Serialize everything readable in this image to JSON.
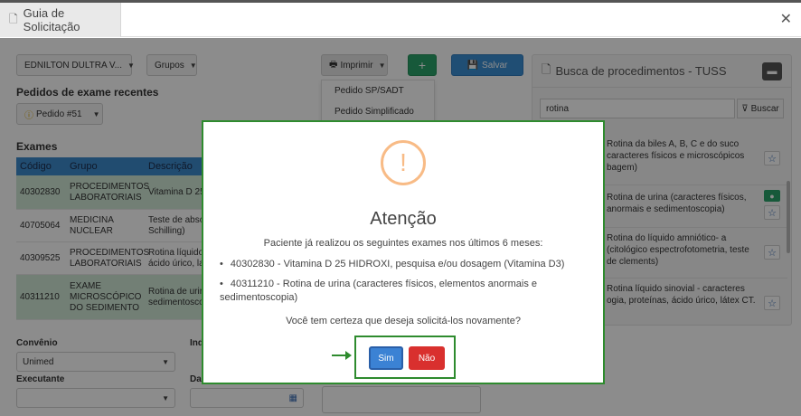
{
  "window": {
    "title": "Guia de Solicitação"
  },
  "toolbar": {
    "patient": "EDNILTON DULTRA V...",
    "groups": "Grupos",
    "print": "Imprimir",
    "add": "+",
    "save": "Salvar"
  },
  "print_menu": [
    "Pedido SP/SADT",
    "Pedido Simplificado"
  ],
  "recent": {
    "title": "Pedidos de exame recentes",
    "order": "Pedido #51"
  },
  "exams": {
    "title": "Exames",
    "headers": [
      "Código",
      "Grupo",
      "Descrição"
    ],
    "rows": [
      {
        "code": "40302830",
        "group": "PROCEDIMENTOS LABORATORIAIS",
        "desc": "Vitamina D 25"
      },
      {
        "code": "40705064",
        "group": "MEDICINA NUCLEAR",
        "desc": "Teste de abso Schilling)"
      },
      {
        "code": "40309525",
        "group": "PROCEDIMENTOS LABORATORIAIS",
        "desc": "Rotina líquido ácido úrico, la"
      },
      {
        "code": "40311210",
        "group": "EXAME MICROSCÓPICO DO SEDIMENTO",
        "desc": "Rotina de urir sedimentosco"
      }
    ]
  },
  "form": {
    "convenio_label": "Convênio",
    "convenio_value": "Unimed",
    "ind_label": "Ind",
    "executante_label": "Executante",
    "da_label": "Da"
  },
  "search": {
    "title": "Busca de procedimentos - TUSS",
    "value": "rotina",
    "button": "Buscar",
    "results": [
      "Rotina da biles A, B, C e do suco caracteres físicos e microscópicos bagem)",
      "Rotina de urina (caracteres físicos, anormais e sedimentoscopia)",
      "Rotina do líquido amniótico- a (citológico espectrofotometria, teste de clements)",
      "Rotina líquido sinovial - caracteres ogia, proteínas, ácido úrico, látex CT."
    ]
  },
  "modal": {
    "title": "Atenção",
    "intro": "Paciente já realizou os seguintes exames nos últimos 6 meses:",
    "items": [
      "40302830 - Vitamina D 25 HIDROXI, pesquisa e/ou dosagem (Vitamina D3)",
      "40311210 - Rotina de urina (caracteres físicos, elementos anormais e sedimentoscopia)"
    ],
    "confirm": "Você tem certeza que deseja solicitá-los novamente?",
    "yes": "Sim",
    "no": "Não"
  },
  "colors": {
    "accent": "#3b82d4",
    "danger": "#d9302e",
    "success": "#2aa36b",
    "highlight": "#2e8b2e",
    "warning": "#f8bb86"
  }
}
